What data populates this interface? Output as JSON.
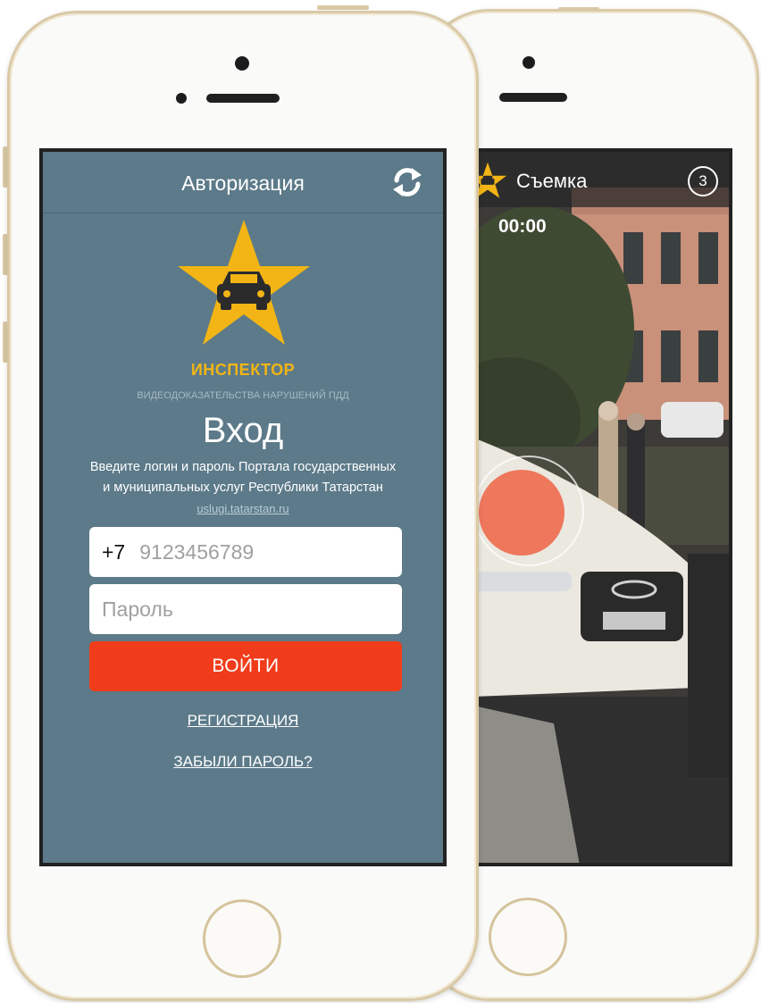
{
  "login_screen": {
    "nav_title": "Авторизация",
    "refresh_icon": "refresh-icon",
    "logo_icon": "star-car-logo-icon",
    "brand_name": "ИНСПЕКТОР",
    "brand_subtitle": "ВИДЕОДОКАЗАТЕЛЬСТВА НАРУШЕНИЙ ПДД",
    "heading": "Вход",
    "description_line1": "Введите логин и пароль Портала государственных",
    "description_line2": "и муниципальных услуг Республики Татарстан",
    "portal_link": "uslugi.tatarstan.ru",
    "phone_prefix": "+7",
    "phone_placeholder": "9123456789",
    "password_placeholder": "Пароль",
    "login_button": "ВОЙТИ",
    "register_link": "РЕГИСТРАЦИЯ",
    "forgot_link": "ЗАБЫЛИ ПАРОЛЬ?"
  },
  "camera_screen": {
    "title": "Съемка",
    "logo_icon": "star-car-logo-icon",
    "counter": "3",
    "timer": "00:00",
    "record_icon": "record-button-icon"
  },
  "colors": {
    "login_background": "#5c7a89",
    "brand_yellow": "#f2b515",
    "login_button": "#f03c1a",
    "record_button": "#ee6a4e"
  }
}
